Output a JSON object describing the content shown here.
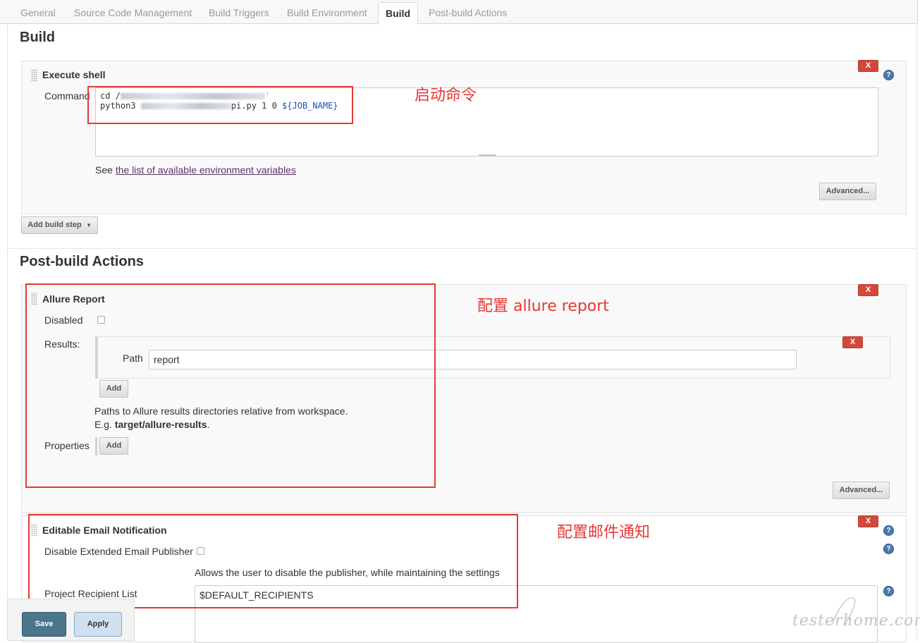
{
  "tabs": [
    {
      "label": "General"
    },
    {
      "label": "Source Code Management"
    },
    {
      "label": "Build Triggers"
    },
    {
      "label": "Build Environment"
    },
    {
      "label": "Build",
      "active": true
    },
    {
      "label": "Post-build Actions"
    }
  ],
  "build": {
    "section_title": "Build",
    "execute_shell": {
      "title": "Execute shell",
      "command_label": "Command",
      "command_lines": [
        "cd /",
        "python3 ",
        "pi.py 1 0 ",
        "${JOB_NAME}"
      ],
      "env_note_prefix": "See ",
      "env_link": "the list of available environment variables",
      "advanced_label": "Advanced...",
      "delete_label": "X",
      "help_icon": "?"
    },
    "add_step_label": "Add build step"
  },
  "post_build": {
    "section_title": "Post-build Actions",
    "allure": {
      "title": "Allure Report",
      "disabled_label": "Disabled",
      "disabled_checked": false,
      "results_label": "Results:",
      "path_label": "Path",
      "path_value": "report",
      "add_label": "Add",
      "note_line1": "Paths to Allure results directories relative from workspace.",
      "note_line2_prefix": "E.g. ",
      "note_line2_bold": "target/allure-results",
      "note_line2_suffix": ".",
      "properties_label": "Properties",
      "properties_add_label": "Add",
      "advanced_label": "Advanced...",
      "delete_label": "X"
    },
    "email": {
      "title": "Editable Email Notification",
      "disable_label": "Disable Extended Email Publisher",
      "disable_checked": false,
      "disable_note": "Allows the user to disable the publisher, while maintaining the settings",
      "recipients_label": "Project Recipient List",
      "recipients_value": "$DEFAULT_RECIPIENTS",
      "delete_label": "X"
    }
  },
  "annotations": {
    "start_command": "启动命令",
    "allure_config": "配置 allure report",
    "email_config": "配置邮件通知"
  },
  "footer": {
    "save_label": "Save",
    "apply_label": "Apply"
  },
  "watermark": "testerhome.com",
  "colors": {
    "delete_button": "#d24939",
    "annotation_red": "#e53935",
    "save_button": "#4b758b",
    "apply_button": "#cfe0f1",
    "help_icon": "#4a79b1"
  }
}
